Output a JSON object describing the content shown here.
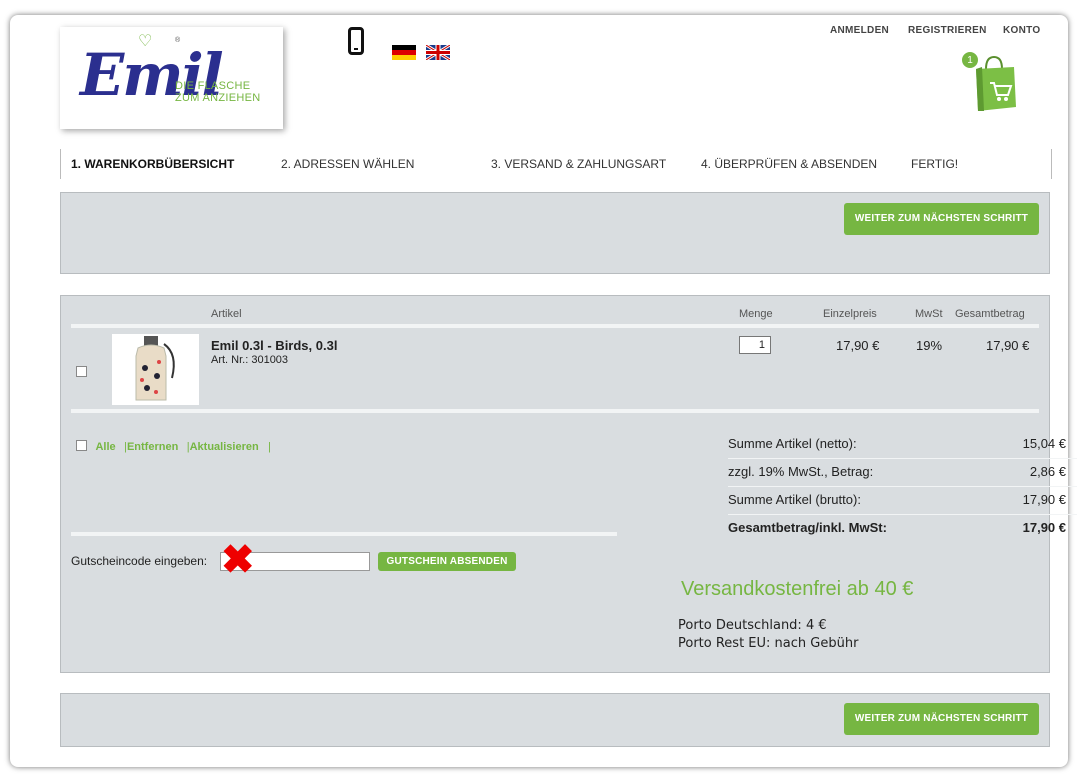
{
  "header": {
    "logo": {
      "word": "Emil",
      "reg_mark": "®",
      "tagline_line1": "DIE FLASCHE",
      "tagline_line2": "ZUM ANZIEHEN"
    },
    "icons": [
      "smartphone-icon",
      "flag-germany-icon",
      "flag-uk-icon",
      "shopping-bag-icon"
    ],
    "top_links": {
      "login": "ANMELDEN",
      "register": "REGISTRIEREN",
      "account": "KONTO"
    },
    "cart_count": "1"
  },
  "steps": [
    {
      "label": "1. WARENKORBÜBERSICHT",
      "active": true
    },
    {
      "label": "2. ADRESSEN WÄHLEN"
    },
    {
      "label": "3. VERSAND & ZAHLUNGSART"
    },
    {
      "label": "4. ÜBERPRÜFEN & ABSENDEN"
    },
    {
      "label": "FERTIG!"
    }
  ],
  "next_button": "WEITER ZUM NÄCHSTEN SCHRITT",
  "cart": {
    "columns": {
      "article": "Artikel",
      "quantity": "Menge",
      "unit_price": "Einzelpreis",
      "vat": "MwSt",
      "total": "Gesamtbetrag"
    },
    "items": [
      {
        "name": "Emil 0.3l - Birds, 0.3l",
        "article_no": "Art. Nr.: 301003",
        "quantity": "1",
        "unit_price": "17,90 €",
        "vat": "19%",
        "total": "17,90 €"
      }
    ],
    "actions": {
      "all": "Alle",
      "remove": "Entfernen",
      "update": "Aktualisieren",
      "separator": "|"
    }
  },
  "coupon": {
    "label": "Gutscheincode eingeben:",
    "value": "",
    "button": "GUTSCHEIN ABSENDEN"
  },
  "totals": [
    {
      "label": "Summe Artikel (netto):",
      "value": "15,04 €"
    },
    {
      "label": "zzgl. 19% MwSt., Betrag:",
      "value": "2,86 €"
    },
    {
      "label": "Summe Artikel (brutto):",
      "value": "17,90 €"
    },
    {
      "label": "Gesamtbetrag/inkl. MwSt:",
      "value": "17,90 €",
      "bold": true
    }
  ],
  "shipping": {
    "headline": "Versandkostenfrei ab 40 €",
    "line1": "Porto Deutschland: 4 €",
    "line2": "Porto Rest EU: nach Gebühr"
  },
  "colors": {
    "accent_green": "#76b642",
    "panel_gray": "#d9dde0",
    "logo_blue": "#2b2f8f",
    "error_red": "#e00000"
  }
}
